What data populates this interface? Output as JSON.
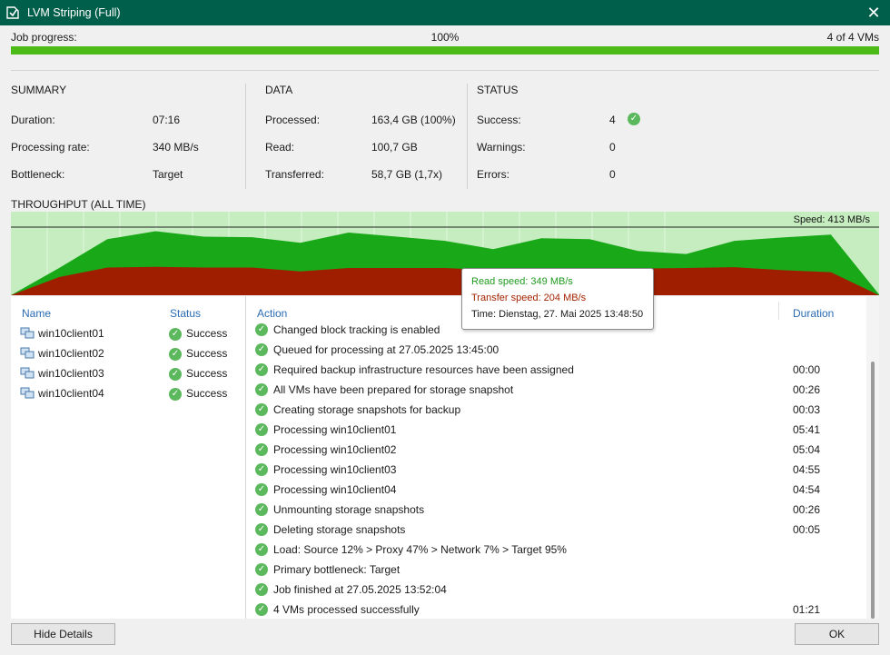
{
  "window": {
    "title": "LVM Striping (Full)",
    "close": "✕"
  },
  "progress": {
    "label": "Job progress:",
    "percent_text": "100%",
    "count_text": "4 of 4 VMs",
    "fill_percent": 100
  },
  "summary": {
    "header": "SUMMARY",
    "rows": [
      {
        "label": "Duration:",
        "value": "07:16"
      },
      {
        "label": "Processing rate:",
        "value": "340 MB/s"
      },
      {
        "label": "Bottleneck:",
        "value": "Target"
      }
    ]
  },
  "data": {
    "header": "DATA",
    "rows": [
      {
        "label": "Processed:",
        "value": "163,4 GB (100%)"
      },
      {
        "label": "Read:",
        "value": "100,7 GB"
      },
      {
        "label": "Transferred:",
        "value": "58,7 GB (1,7x)"
      }
    ]
  },
  "status": {
    "header": "STATUS",
    "rows": [
      {
        "label": "Success:",
        "value": "4"
      },
      {
        "label": "Warnings:",
        "value": "0"
      },
      {
        "label": "Errors:",
        "value": "0"
      }
    ]
  },
  "throughput": {
    "label": "THROUGHPUT (ALL TIME)",
    "speed_label": "Speed: 413 MB/s",
    "tooltip": {
      "read": "Read speed: 349 MB/s",
      "transfer": "Transfer speed: 204 MB/s",
      "time": "Time: Dienstag, 27. Mai 2025 13:48:50"
    }
  },
  "chart_data": {
    "type": "area",
    "title": "THROUGHPUT (ALL TIME)",
    "ylim": [
      0,
      413
    ],
    "series": [
      {
        "name": "Read speed",
        "values": [
          0,
          165,
          340,
          388,
          355,
          352,
          318,
          380,
          355,
          330,
          280,
          345,
          340,
          268,
          250,
          330,
          350,
          368,
          5
        ]
      },
      {
        "name": "Transfer speed",
        "values": [
          0,
          110,
          168,
          172,
          168,
          168,
          145,
          165,
          165,
          165,
          152,
          162,
          162,
          162,
          165,
          170,
          152,
          140,
          0
        ]
      }
    ]
  },
  "colors": {
    "title_bar": "#005f4a",
    "progress": "#4cbb17",
    "read_area": "#18a818",
    "transfer_area": "#a01e00",
    "chart_bg": "#c6edc0",
    "link": "#2a6bb3"
  },
  "vm_table": {
    "headers": {
      "name": "Name",
      "status": "Status"
    },
    "rows": [
      {
        "name": "win10client01",
        "status": "Success"
      },
      {
        "name": "win10client02",
        "status": "Success"
      },
      {
        "name": "win10client03",
        "status": "Success"
      },
      {
        "name": "win10client04",
        "status": "Success"
      }
    ]
  },
  "action_table": {
    "headers": {
      "action": "Action",
      "duration": "Duration"
    },
    "rows": [
      {
        "action": "Changed block tracking is enabled",
        "duration": ""
      },
      {
        "action": "Queued for processing at 27.05.2025 13:45:00",
        "duration": ""
      },
      {
        "action": "Required backup infrastructure resources have been assigned",
        "duration": "00:00"
      },
      {
        "action": "All VMs have been prepared for storage snapshot",
        "duration": "00:26"
      },
      {
        "action": "Creating storage snapshots for backup",
        "duration": "00:03"
      },
      {
        "action": "Processing win10client01",
        "duration": "05:41"
      },
      {
        "action": "Processing win10client02",
        "duration": "05:04"
      },
      {
        "action": "Processing win10client03",
        "duration": "04:55"
      },
      {
        "action": "Processing win10client04",
        "duration": "04:54"
      },
      {
        "action": "Unmounting storage snapshots",
        "duration": "00:26"
      },
      {
        "action": "Deleting storage snapshots",
        "duration": "00:05"
      },
      {
        "action": "Load: Source 12% > Proxy 47% > Network 7% > Target 95%",
        "duration": ""
      },
      {
        "action": "Primary bottleneck: Target",
        "duration": ""
      },
      {
        "action": "Job finished at 27.05.2025 13:52:04",
        "duration": ""
      },
      {
        "action": "4 VMs processed successfully",
        "duration": "01:21"
      }
    ]
  },
  "buttons": {
    "hide_details": "Hide Details",
    "ok": "OK"
  }
}
